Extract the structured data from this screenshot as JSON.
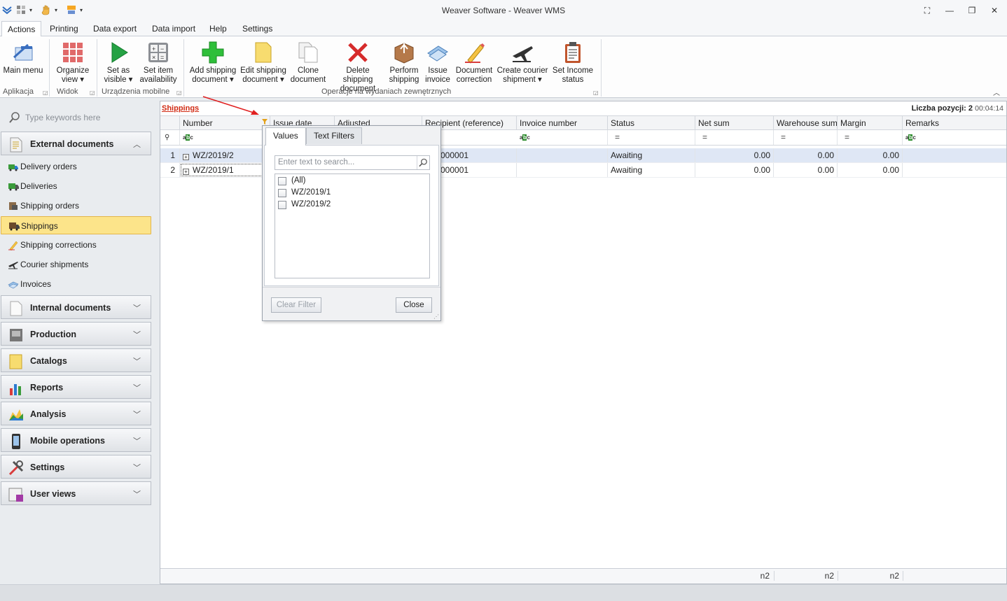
{
  "window": {
    "title": "Weaver Software - Weaver WMS"
  },
  "menu_tabs": [
    "Actions",
    "Printing",
    "Data export",
    "Data import",
    "Help",
    "Settings"
  ],
  "ribbon": {
    "buttons": [
      {
        "label1": "Main menu",
        "label2": ""
      },
      {
        "label1": "Organize",
        "label2": "view ▾"
      },
      {
        "label1": "Set as",
        "label2": "visible ▾"
      },
      {
        "label1": "Set item",
        "label2": "availability"
      },
      {
        "label1": "Add shipping",
        "label2": "document ▾"
      },
      {
        "label1": "Edit shipping",
        "label2": "document ▾"
      },
      {
        "label1": "Clone",
        "label2": "document"
      },
      {
        "label1": "Delete shipping",
        "label2": "document"
      },
      {
        "label1": "Perform",
        "label2": "shipping"
      },
      {
        "label1": "Issue",
        "label2": "invoice"
      },
      {
        "label1": "Document",
        "label2": "correction"
      },
      {
        "label1": "Create courier",
        "label2": "shipment ▾"
      },
      {
        "label1": "Set Income",
        "label2": "status"
      }
    ],
    "groups": [
      "Aplikacja",
      "Widok",
      "Urządzenia mobilne",
      "Operacje na wydaniach zewnętrznych"
    ]
  },
  "sidebar": {
    "search_placeholder": "Type keywords here",
    "external_documents": "External documents",
    "items": [
      "Delivery orders",
      "Deliveries",
      "Shipping orders",
      "Shippings",
      "Shipping corrections",
      "Courier shipments",
      "Invoices"
    ],
    "selected_item": "Shippings",
    "sections": [
      "Internal documents",
      "Production",
      "Catalogs",
      "Reports",
      "Analysis",
      "Mobile operations",
      "Settings",
      "User views"
    ]
  },
  "main": {
    "breadcrumb": "Shippings",
    "count_label": "Liczba pozycji: 2",
    "time": "00:04:14",
    "columns": [
      "Number",
      "Issue date",
      "Adjusted",
      "Recipient (reference)",
      "Invoice number",
      "Status",
      "Net sum",
      "Warehouse sum",
      "Margin",
      "Remarks"
    ],
    "rows": [
      {
        "num": "1",
        "number": "WZ/2019/2",
        "recipient": "000001",
        "invoice": "",
        "status": "Awaiting",
        "net": "0.00",
        "warehouse": "0.00",
        "margin": "0.00",
        "remarks": ""
      },
      {
        "num": "2",
        "number": "WZ/2019/1",
        "recipient": "000001",
        "invoice": "",
        "status": "Awaiting",
        "net": "0.00",
        "warehouse": "0.00",
        "margin": "0.00",
        "remarks": ""
      }
    ],
    "footer": [
      "n2",
      "n2",
      "n2"
    ]
  },
  "filter_popup": {
    "tabs": [
      "Values",
      "Text Filters"
    ],
    "search_placeholder": "Enter text to search...",
    "options": [
      "(All)",
      "WZ/2019/1",
      "WZ/2019/2"
    ],
    "clear_label": "Clear Filter",
    "close_label": "Close"
  }
}
